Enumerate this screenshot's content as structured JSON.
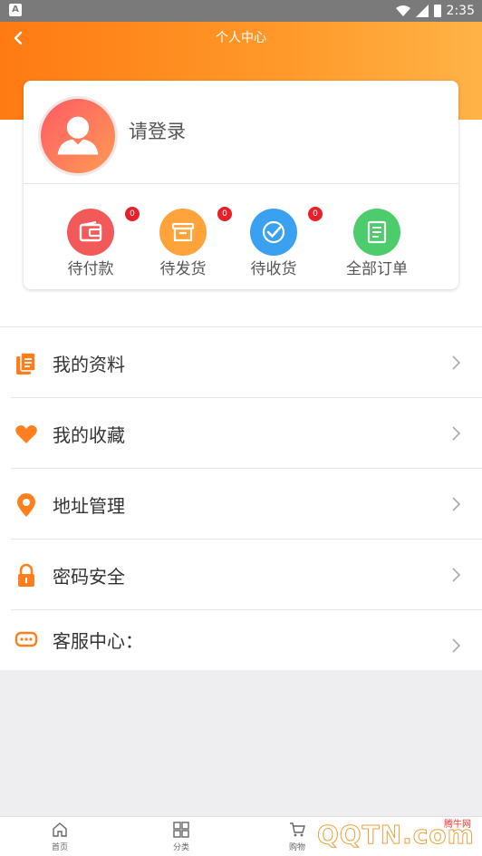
{
  "status_bar": {
    "time": "2:35",
    "notification_icon": "android-icon"
  },
  "header": {
    "title": "个人中心",
    "back_icon": "chevron-left-icon"
  },
  "profile": {
    "login_prompt": "请登录",
    "avatar_icon": "user-silhouette-icon"
  },
  "orders": [
    {
      "label": "待付款",
      "badge": "0",
      "icon": "wallet-icon",
      "color": "#f25a5a"
    },
    {
      "label": "待发货",
      "badge": "0",
      "icon": "box-icon",
      "color": "#ffa33a"
    },
    {
      "label": "待收货",
      "badge": "0",
      "icon": "checkmark-icon",
      "color": "#3aa0f0"
    },
    {
      "label": "全部订单",
      "icon": "document-icon",
      "color": "#4ccc6a"
    }
  ],
  "menu": [
    {
      "label": "我的资料",
      "icon": "profile-document-icon"
    },
    {
      "label": "我的收藏",
      "icon": "heart-icon"
    },
    {
      "label": "地址管理",
      "icon": "location-pin-icon"
    },
    {
      "label": "密码安全",
      "icon": "lock-icon"
    },
    {
      "label": "客服中心：",
      "icon": "chat-bubble-icon"
    }
  ],
  "tabs": [
    {
      "label": "首页",
      "icon": "home-icon"
    },
    {
      "label": "分类",
      "icon": "grid-icon"
    },
    {
      "label": "购物",
      "icon": "cart-icon"
    }
  ],
  "watermark": {
    "brand": "腾牛网",
    "text": "QQTN.com"
  },
  "colors": {
    "accent": "#ff8a1f",
    "badge": "#e8202a"
  }
}
